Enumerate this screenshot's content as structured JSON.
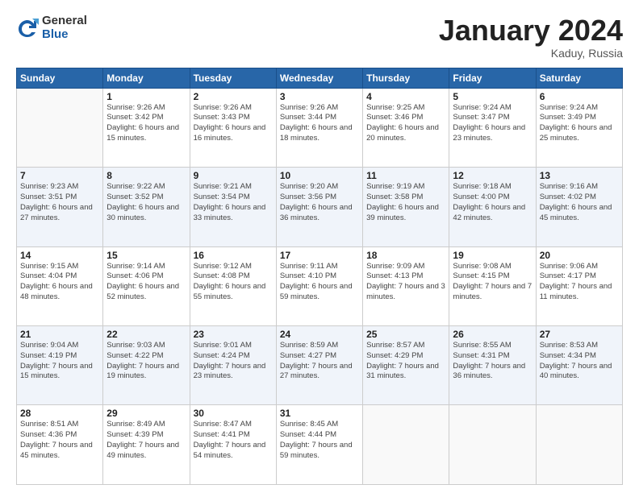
{
  "logo": {
    "general": "General",
    "blue": "Blue"
  },
  "title": "January 2024",
  "subtitle": "Kaduy, Russia",
  "days_of_week": [
    "Sunday",
    "Monday",
    "Tuesday",
    "Wednesday",
    "Thursday",
    "Friday",
    "Saturday"
  ],
  "weeks": [
    [
      {
        "day": "",
        "sunrise": "",
        "sunset": "",
        "daylight": ""
      },
      {
        "day": "1",
        "sunrise": "9:26 AM",
        "sunset": "3:42 PM",
        "daylight": "6 hours and 15 minutes."
      },
      {
        "day": "2",
        "sunrise": "9:26 AM",
        "sunset": "3:43 PM",
        "daylight": "6 hours and 16 minutes."
      },
      {
        "day": "3",
        "sunrise": "9:26 AM",
        "sunset": "3:44 PM",
        "daylight": "6 hours and 18 minutes."
      },
      {
        "day": "4",
        "sunrise": "9:25 AM",
        "sunset": "3:46 PM",
        "daylight": "6 hours and 20 minutes."
      },
      {
        "day": "5",
        "sunrise": "9:24 AM",
        "sunset": "3:47 PM",
        "daylight": "6 hours and 23 minutes."
      },
      {
        "day": "6",
        "sunrise": "9:24 AM",
        "sunset": "3:49 PM",
        "daylight": "6 hours and 25 minutes."
      }
    ],
    [
      {
        "day": "7",
        "sunrise": "9:23 AM",
        "sunset": "3:51 PM",
        "daylight": "6 hours and 27 minutes."
      },
      {
        "day": "8",
        "sunrise": "9:22 AM",
        "sunset": "3:52 PM",
        "daylight": "6 hours and 30 minutes."
      },
      {
        "day": "9",
        "sunrise": "9:21 AM",
        "sunset": "3:54 PM",
        "daylight": "6 hours and 33 minutes."
      },
      {
        "day": "10",
        "sunrise": "9:20 AM",
        "sunset": "3:56 PM",
        "daylight": "6 hours and 36 minutes."
      },
      {
        "day": "11",
        "sunrise": "9:19 AM",
        "sunset": "3:58 PM",
        "daylight": "6 hours and 39 minutes."
      },
      {
        "day": "12",
        "sunrise": "9:18 AM",
        "sunset": "4:00 PM",
        "daylight": "6 hours and 42 minutes."
      },
      {
        "day": "13",
        "sunrise": "9:16 AM",
        "sunset": "4:02 PM",
        "daylight": "6 hours and 45 minutes."
      }
    ],
    [
      {
        "day": "14",
        "sunrise": "9:15 AM",
        "sunset": "4:04 PM",
        "daylight": "6 hours and 48 minutes."
      },
      {
        "day": "15",
        "sunrise": "9:14 AM",
        "sunset": "4:06 PM",
        "daylight": "6 hours and 52 minutes."
      },
      {
        "day": "16",
        "sunrise": "9:12 AM",
        "sunset": "4:08 PM",
        "daylight": "6 hours and 55 minutes."
      },
      {
        "day": "17",
        "sunrise": "9:11 AM",
        "sunset": "4:10 PM",
        "daylight": "6 hours and 59 minutes."
      },
      {
        "day": "18",
        "sunrise": "9:09 AM",
        "sunset": "4:13 PM",
        "daylight": "7 hours and 3 minutes."
      },
      {
        "day": "19",
        "sunrise": "9:08 AM",
        "sunset": "4:15 PM",
        "daylight": "7 hours and 7 minutes."
      },
      {
        "day": "20",
        "sunrise": "9:06 AM",
        "sunset": "4:17 PM",
        "daylight": "7 hours and 11 minutes."
      }
    ],
    [
      {
        "day": "21",
        "sunrise": "9:04 AM",
        "sunset": "4:19 PM",
        "daylight": "7 hours and 15 minutes."
      },
      {
        "day": "22",
        "sunrise": "9:03 AM",
        "sunset": "4:22 PM",
        "daylight": "7 hours and 19 minutes."
      },
      {
        "day": "23",
        "sunrise": "9:01 AM",
        "sunset": "4:24 PM",
        "daylight": "7 hours and 23 minutes."
      },
      {
        "day": "24",
        "sunrise": "8:59 AM",
        "sunset": "4:27 PM",
        "daylight": "7 hours and 27 minutes."
      },
      {
        "day": "25",
        "sunrise": "8:57 AM",
        "sunset": "4:29 PM",
        "daylight": "7 hours and 31 minutes."
      },
      {
        "day": "26",
        "sunrise": "8:55 AM",
        "sunset": "4:31 PM",
        "daylight": "7 hours and 36 minutes."
      },
      {
        "day": "27",
        "sunrise": "8:53 AM",
        "sunset": "4:34 PM",
        "daylight": "7 hours and 40 minutes."
      }
    ],
    [
      {
        "day": "28",
        "sunrise": "8:51 AM",
        "sunset": "4:36 PM",
        "daylight": "7 hours and 45 minutes."
      },
      {
        "day": "29",
        "sunrise": "8:49 AM",
        "sunset": "4:39 PM",
        "daylight": "7 hours and 49 minutes."
      },
      {
        "day": "30",
        "sunrise": "8:47 AM",
        "sunset": "4:41 PM",
        "daylight": "7 hours and 54 minutes."
      },
      {
        "day": "31",
        "sunrise": "8:45 AM",
        "sunset": "4:44 PM",
        "daylight": "7 hours and 59 minutes."
      },
      {
        "day": "",
        "sunrise": "",
        "sunset": "",
        "daylight": ""
      },
      {
        "day": "",
        "sunrise": "",
        "sunset": "",
        "daylight": ""
      },
      {
        "day": "",
        "sunrise": "",
        "sunset": "",
        "daylight": ""
      }
    ]
  ],
  "labels": {
    "sunrise_prefix": "Sunrise: ",
    "sunset_prefix": "Sunset: ",
    "daylight_prefix": "Daylight: "
  }
}
